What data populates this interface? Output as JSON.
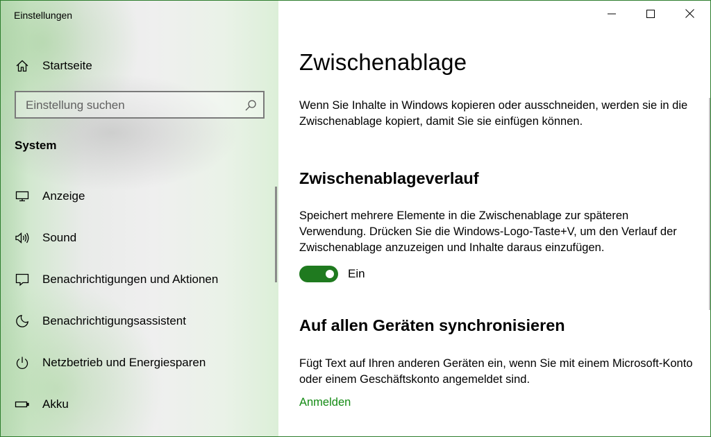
{
  "window": {
    "title": "Einstellungen",
    "controls": {
      "minimize": "minimize",
      "maximize": "maximize",
      "close": "close"
    },
    "accent": "#1f7a1f"
  },
  "sidebar": {
    "home_label": "Startseite",
    "search": {
      "placeholder": "Einstellung suchen",
      "value": ""
    },
    "section_label": "System",
    "items": [
      {
        "label": "Anzeige",
        "icon": "monitor-icon"
      },
      {
        "label": "Sound",
        "icon": "speaker-icon"
      },
      {
        "label": "Benachrichtigungen und Aktionen",
        "icon": "notification-icon"
      },
      {
        "label": "Benachrichtigungsassistent",
        "icon": "moon-icon"
      },
      {
        "label": "Netzbetrieb und Energiesparen",
        "icon": "power-icon"
      },
      {
        "label": "Akku",
        "icon": "battery-icon"
      }
    ]
  },
  "main": {
    "page_title": "Zwischenablage",
    "intro": "Wenn Sie Inhalte in Windows kopieren oder ausschneiden, werden sie in die Zwischenablage kopiert, damit Sie sie einfügen können.",
    "history": {
      "heading": "Zwischenablageverlauf",
      "description": "Speichert mehrere Elemente in die Zwischenablage zur späteren Verwendung. Drücken Sie die Windows-Logo-Taste+V, um den Verlauf der Zwischenablage anzuzeigen und Inhalte daraus einzufügen.",
      "toggle_on": true,
      "toggle_state_label": "Ein"
    },
    "sync": {
      "heading": "Auf allen Geräten synchronisieren",
      "description": "Fügt Text auf Ihren anderen Geräten ein, wenn Sie mit einem Microsoft-Konto oder einem Geschäftskonto angemeldet sind.",
      "link_label": "Anmelden"
    }
  }
}
